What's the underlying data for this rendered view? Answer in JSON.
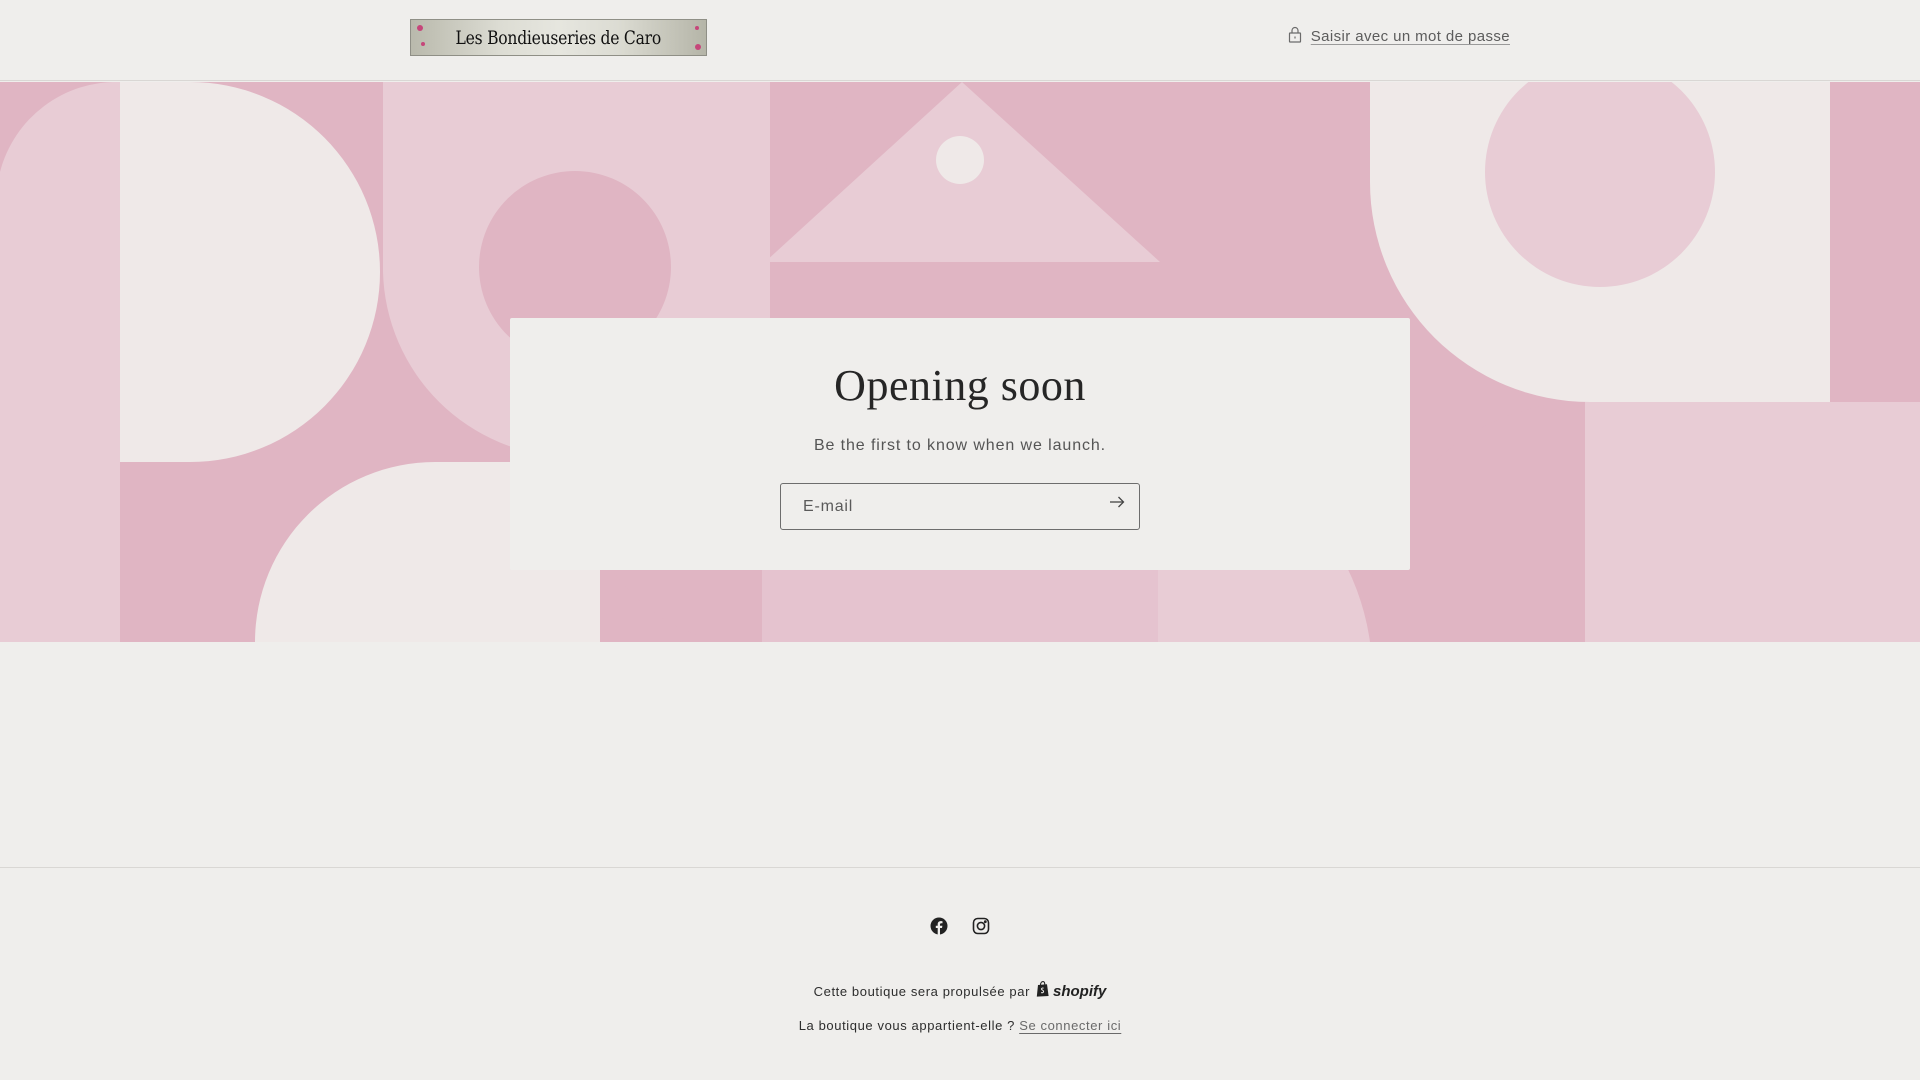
{
  "header": {
    "logo_text": "Les Bondieuseries de Caro",
    "password_link": "Saisir avec un mot de passe",
    "password_icon": "lock-icon"
  },
  "main": {
    "title": "Opening soon",
    "subtitle": "Be the first to know when we launch.",
    "email_placeholder": "E-mail",
    "email_value": "",
    "submit_icon": "arrow-right-icon"
  },
  "footer": {
    "social": [
      {
        "name": "Facebook",
        "icon": "facebook-icon"
      },
      {
        "name": "Instagram",
        "icon": "instagram-icon"
      }
    ],
    "powered_text": "Cette boutique sera propulsée par",
    "powered_brand": "shopify",
    "owner_text": "La boutique vous appartient-elle ?",
    "owner_link": "Se connecter ici"
  },
  "colors": {
    "background": "#efeeec",
    "hero_pink_dark": "#e0b5c3",
    "hero_pink_light": "#e8ccd5",
    "hero_cream": "#efe9e8"
  }
}
